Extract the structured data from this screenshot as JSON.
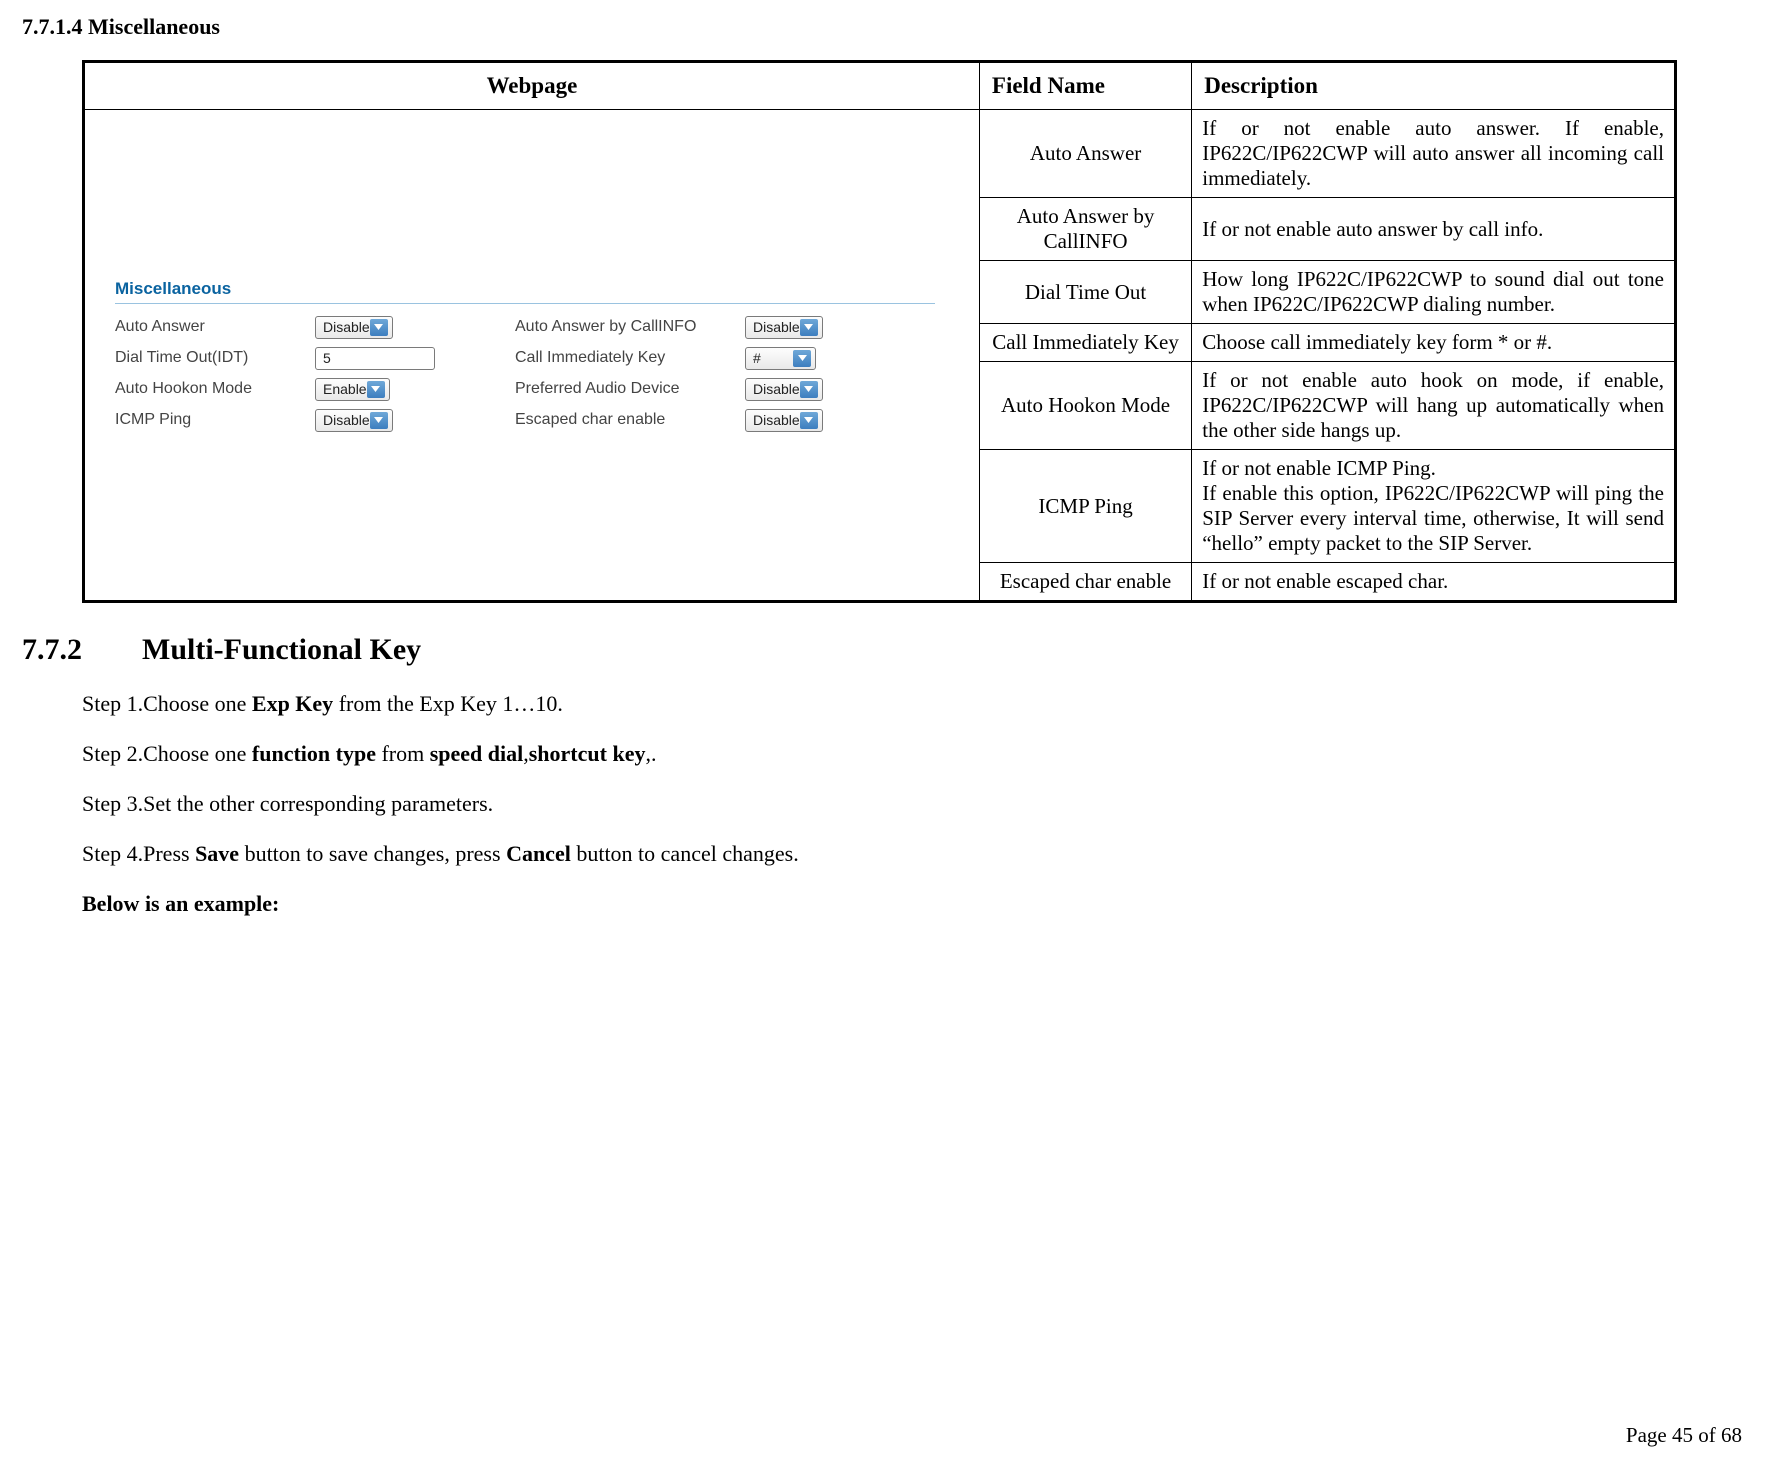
{
  "headings": {
    "h_77114": "7.7.1.4  Miscellaneous",
    "h_772_num": "7.7.2",
    "h_772_title": "Multi-Functional Key"
  },
  "table": {
    "headers": {
      "webpage": "Webpage",
      "field": "Field Name",
      "desc": "Description"
    },
    "rows": [
      {
        "field": "Auto Answer",
        "desc": "If or not enable auto answer. If enable, IP622C/IP622CWP will auto answer all incoming call immediately."
      },
      {
        "field": "Auto Answer by CallINFO",
        "desc": "If or not enable auto answer by call info."
      },
      {
        "field": "Dial Time Out",
        "desc": "How long IP622C/IP622CWP to sound dial out tone when IP622C/IP622CWP dialing number."
      },
      {
        "field": "Call Immediately Key",
        "desc": "Choose call immediately key form * or #."
      },
      {
        "field": "Auto Hookon Mode",
        "desc": "If or not enable auto hook on mode, if enable, IP622C/IP622CWP will hang up automatically when the other side hangs up."
      },
      {
        "field": "ICMP Ping",
        "desc": "If or not enable ICMP Ping.\nIf enable this option, IP622C/IP622CWP will ping the SIP Server every interval time, otherwise, It will send “hello” empty packet to the SIP Server."
      },
      {
        "field": "Escaped char enable",
        "desc": "If or not enable escaped char."
      }
    ]
  },
  "screenshot": {
    "title": "Miscellaneous",
    "labels": {
      "auto_answer": "Auto Answer",
      "dial_time_out": "Dial Time Out(IDT)",
      "auto_hookon": "Auto Hookon Mode",
      "icmp_ping": "ICMP Ping",
      "auto_answer_callinfo": "Auto Answer by CallINFO",
      "call_imm_key": "Call Immediately Key",
      "pref_audio": "Preferred Audio Device",
      "escaped_char": "Escaped char enable"
    },
    "values": {
      "auto_answer": "Disable",
      "dial_time_out": "5",
      "auto_hookon": "Enable",
      "icmp_ping": "Disable",
      "auto_answer_callinfo": "Disable",
      "call_imm_key": "#",
      "pref_audio": "Disable",
      "escaped_char": "Disable"
    }
  },
  "steps": {
    "s1_a": "Step 1.Choose one ",
    "s1_b": "Exp Key",
    "s1_c": " from the Exp Key 1…10.",
    "s2_a": "Step 2.Choose one ",
    "s2_b": "function type",
    "s2_c": " from ",
    "s2_d": "speed dial",
    "s2_e": ",",
    "s2_f": "shortcut key",
    "s2_g": ",.",
    "s3": "Step 3.Set the other corresponding parameters.",
    "s4_a": "Step 4.Press ",
    "s4_b": "Save",
    "s4_c": " button to save changes, press ",
    "s4_d": "Cancel",
    "s4_e": " button to cancel changes.",
    "below": "Below is an example:"
  },
  "footer": "Page 45 of 68"
}
